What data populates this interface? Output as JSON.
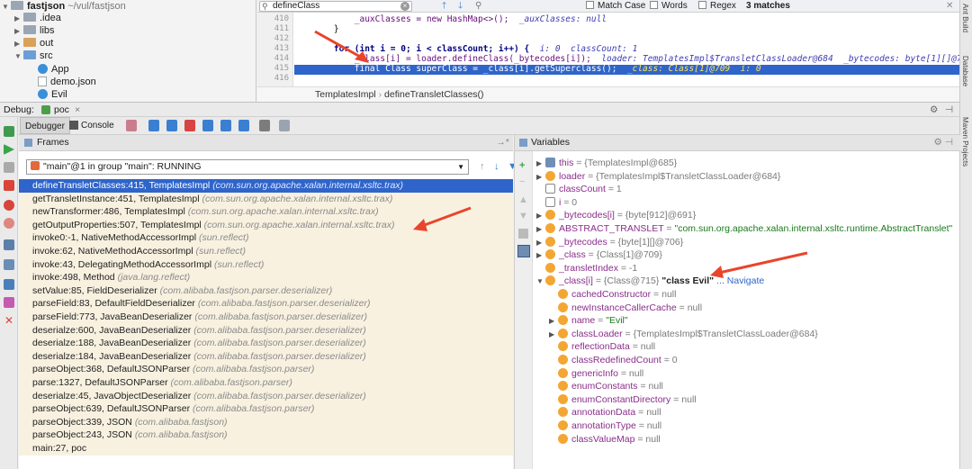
{
  "project": {
    "root_name": "fastjson",
    "root_path": "~/vul/fastjson",
    "items": [
      {
        "label": "fastjson",
        "kind": "root"
      },
      {
        "label": ".idea",
        "kind": "folder"
      },
      {
        "label": "libs",
        "kind": "folder"
      },
      {
        "label": "out",
        "kind": "folder-orange"
      },
      {
        "label": "src",
        "kind": "folder-blue"
      },
      {
        "label": "App",
        "kind": "class"
      },
      {
        "label": "demo.json",
        "kind": "file"
      },
      {
        "label": "Evil",
        "kind": "class"
      }
    ]
  },
  "search": {
    "query": "defineClass",
    "match_case": "Match Case",
    "words": "Words",
    "regex": "Regex",
    "matches": "3 matches"
  },
  "editor": {
    "line_numbers": [
      "410",
      "411",
      "412",
      "413",
      "414",
      "415",
      "416"
    ],
    "lines": [
      {
        "code": "        _auxClasses = new HashMap<>();",
        "hint": "  _auxClasses: null"
      },
      {
        "code": "    }",
        "hint": ""
      },
      {
        "code": "",
        "hint": ""
      },
      {
        "code": "    for (int i = 0; i < classCount; i++) {",
        "hint": "  i: 0  classCount: 1"
      },
      {
        "code": "        _class[i] = loader.defineClass(_bytecodes[i]);",
        "hint": "  loader: TemplatesImpl$TransletClassLoader@684  _bytecodes: byte[1][]@7"
      },
      {
        "code": "        final Class superClass = _class[i].getSuperclass();",
        "hint": "  _class: Class[1]@709  i: 0"
      },
      {
        "code": "",
        "hint": ""
      }
    ],
    "breadcrumb": [
      "TemplatesImpl",
      "defineTransletClasses()"
    ]
  },
  "right_strip": {
    "labels": [
      "Ant Build",
      "Database",
      "Maven Projects"
    ]
  },
  "debug": {
    "label": "Debug:",
    "session": "poc",
    "tabs": [
      "Debugger",
      "Console"
    ],
    "frames_title": "Frames",
    "variables_title": "Variables",
    "thread": "\"main\"@1 in group \"main\": RUNNING"
  },
  "frames": [
    {
      "method": "defineTransletClasses:415, TemplatesImpl",
      "pkg": "(com.sun.org.apache.xalan.internal.xsltc.trax)"
    },
    {
      "method": "getTransletInstance:451, TemplatesImpl",
      "pkg": "(com.sun.org.apache.xalan.internal.xsltc.trax)"
    },
    {
      "method": "newTransformer:486, TemplatesImpl",
      "pkg": "(com.sun.org.apache.xalan.internal.xsltc.trax)"
    },
    {
      "method": "getOutputProperties:507, TemplatesImpl",
      "pkg": "(com.sun.org.apache.xalan.internal.xsltc.trax)"
    },
    {
      "method": "invoke0:-1, NativeMethodAccessorImpl",
      "pkg": "(sun.reflect)"
    },
    {
      "method": "invoke:62, NativeMethodAccessorImpl",
      "pkg": "(sun.reflect)"
    },
    {
      "method": "invoke:43, DelegatingMethodAccessorImpl",
      "pkg": "(sun.reflect)"
    },
    {
      "method": "invoke:498, Method",
      "pkg": "(java.lang.reflect)"
    },
    {
      "method": "setValue:85, FieldDeserializer",
      "pkg": "(com.alibaba.fastjson.parser.deserializer)"
    },
    {
      "method": "parseField:83, DefaultFieldDeserializer",
      "pkg": "(com.alibaba.fastjson.parser.deserializer)"
    },
    {
      "method": "parseField:773, JavaBeanDeserializer",
      "pkg": "(com.alibaba.fastjson.parser.deserializer)"
    },
    {
      "method": "deserialze:600, JavaBeanDeserializer",
      "pkg": "(com.alibaba.fastjson.parser.deserializer)"
    },
    {
      "method": "deserialze:188, JavaBeanDeserializer",
      "pkg": "(com.alibaba.fastjson.parser.deserializer)"
    },
    {
      "method": "deserialze:184, JavaBeanDeserializer",
      "pkg": "(com.alibaba.fastjson.parser.deserializer)"
    },
    {
      "method": "parseObject:368, DefaultJSONParser",
      "pkg": "(com.alibaba.fastjson.parser)"
    },
    {
      "method": "parse:1327, DefaultJSONParser",
      "pkg": "(com.alibaba.fastjson.parser)"
    },
    {
      "method": "deserialze:45, JavaObjectDeserializer",
      "pkg": "(com.alibaba.fastjson.parser.deserializer)"
    },
    {
      "method": "parseObject:639, DefaultJSONParser",
      "pkg": "(com.alibaba.fastjson.parser)"
    },
    {
      "method": "parseObject:339, JSON",
      "pkg": "(com.alibaba.fastjson)"
    },
    {
      "method": "parseObject:243, JSON",
      "pkg": "(com.alibaba.fastjson)"
    },
    {
      "method": "main:27, poc",
      "pkg": ""
    }
  ],
  "variables": [
    {
      "indent": 0,
      "expand": "▶",
      "icon": "eq",
      "name": "this",
      "value": " = {TemplatesImpl@685}",
      "extra": "",
      "nav": ""
    },
    {
      "indent": 0,
      "expand": "▶",
      "icon": "f",
      "name": "loader",
      "value": " = {TemplatesImpl$TransletClassLoader@684}",
      "extra": "",
      "nav": ""
    },
    {
      "indent": 0,
      "expand": "",
      "icon": "w",
      "name": "classCount",
      "value": " = 1",
      "extra": "",
      "nav": ""
    },
    {
      "indent": 0,
      "expand": "",
      "icon": "w",
      "name": "i",
      "value": " = 0",
      "extra": "",
      "nav": ""
    },
    {
      "indent": 0,
      "expand": "▶",
      "icon": "f",
      "name": "_bytecodes[i]",
      "value": " = {byte[912]@691}",
      "extra": "",
      "nav": ""
    },
    {
      "indent": 0,
      "expand": "▶",
      "icon": "f",
      "name": "ABSTRACT_TRANSLET",
      "value": " = ",
      "extra": "\"com.sun.org.apache.xalan.internal.xsltc.runtime.AbstractTranslet\"",
      "nav": ""
    },
    {
      "indent": 0,
      "expand": "▶",
      "icon": "f",
      "name": "_bytecodes",
      "value": " = {byte[1][]@706}",
      "extra": "",
      "nav": ""
    },
    {
      "indent": 0,
      "expand": "▶",
      "icon": "f",
      "name": "_class",
      "value": " = {Class[1]@709}",
      "extra": "",
      "nav": ""
    },
    {
      "indent": 0,
      "expand": "",
      "icon": "f",
      "name": "_transletIndex",
      "value": " = -1",
      "extra": "",
      "nav": ""
    },
    {
      "indent": 0,
      "expand": "▼",
      "icon": "f",
      "name": "_class[i]",
      "value": " = {Class@715} ",
      "extra": "\"class Evil\"",
      "nav": "... Navigate"
    },
    {
      "indent": 1,
      "expand": "",
      "icon": "f",
      "name": "cachedConstructor",
      "value": " = null",
      "extra": "",
      "nav": ""
    },
    {
      "indent": 1,
      "expand": "",
      "icon": "f",
      "name": "newInstanceCallerCache",
      "value": " = null",
      "extra": "",
      "nav": ""
    },
    {
      "indent": 1,
      "expand": "▶",
      "icon": "f",
      "name": "name",
      "value": " = ",
      "extra": "\"Evil\"",
      "nav": ""
    },
    {
      "indent": 1,
      "expand": "▶",
      "icon": "f",
      "name": "classLoader",
      "value": " = {TemplatesImpl$TransletClassLoader@684}",
      "extra": "",
      "nav": ""
    },
    {
      "indent": 1,
      "expand": "",
      "icon": "f",
      "name": "reflectionData",
      "value": " = null",
      "extra": "",
      "nav": ""
    },
    {
      "indent": 1,
      "expand": "",
      "icon": "f",
      "name": "classRedefinedCount",
      "value": " = 0",
      "extra": "",
      "nav": ""
    },
    {
      "indent": 1,
      "expand": "",
      "icon": "f",
      "name": "genericInfo",
      "value": " = null",
      "extra": "",
      "nav": ""
    },
    {
      "indent": 1,
      "expand": "",
      "icon": "f",
      "name": "enumConstants",
      "value": " = null",
      "extra": "",
      "nav": ""
    },
    {
      "indent": 1,
      "expand": "",
      "icon": "f",
      "name": "enumConstantDirectory",
      "value": " = null",
      "extra": "",
      "nav": ""
    },
    {
      "indent": 1,
      "expand": "",
      "icon": "f",
      "name": "annotationData",
      "value": " = null",
      "extra": "",
      "nav": ""
    },
    {
      "indent": 1,
      "expand": "",
      "icon": "f",
      "name": "annotationType",
      "value": " = null",
      "extra": "",
      "nav": ""
    },
    {
      "indent": 1,
      "expand": "",
      "icon": "f",
      "name": "classValueMap",
      "value": " = null",
      "extra": "",
      "nav": ""
    }
  ],
  "colors": {
    "selection": "#2f65ca",
    "frame_bg": "#f8f1e0",
    "annotation_arrow": "#e8452c"
  }
}
